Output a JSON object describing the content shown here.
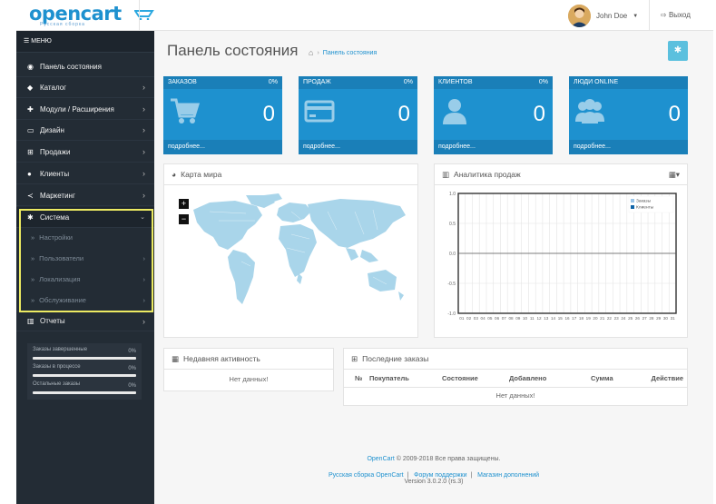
{
  "header": {
    "logo_text": "opencart",
    "logo_tagline": "Русская сборка",
    "user_name": "John Doe",
    "logout_label": "Выход"
  },
  "sidebar": {
    "menu_label": "МЕНЮ",
    "items": [
      {
        "label": "Панель состояния",
        "icon": "dashboard-icon"
      },
      {
        "label": "Каталог",
        "icon": "tag-icon"
      },
      {
        "label": "Модули / Расширения",
        "icon": "puzzle-icon"
      },
      {
        "label": "Дизайн",
        "icon": "monitor-icon"
      },
      {
        "label": "Продажи",
        "icon": "cart-icon"
      },
      {
        "label": "Клиенты",
        "icon": "user-icon"
      },
      {
        "label": "Маркетинг",
        "icon": "share-icon"
      },
      {
        "label": "Система",
        "icon": "gear-icon"
      }
    ],
    "system_subitems": [
      {
        "label": "Настройки"
      },
      {
        "label": "Пользователи"
      },
      {
        "label": "Локализация"
      },
      {
        "label": "Обслуживание"
      }
    ],
    "reports_label": "Отчеты",
    "stats": [
      {
        "label": "Заказы завершенные",
        "percent": "0%",
        "fill": 0
      },
      {
        "label": "Заказы в процессе",
        "percent": "0%",
        "fill": 0
      },
      {
        "label": "Остальные заказы",
        "percent": "0%",
        "fill": 0
      }
    ],
    "highlight_color": "#ecea62"
  },
  "main": {
    "page_title": "Панель состояния",
    "breadcrumb": "Панель состояния",
    "tiles": [
      {
        "label": "ЗАКАЗОВ",
        "percent": "0%",
        "value": "0",
        "more": "подробнее...",
        "icon": "cart-icon"
      },
      {
        "label": "ПРОДАЖ",
        "percent": "0%",
        "value": "0",
        "more": "подробнее...",
        "icon": "credit-card-icon"
      },
      {
        "label": "КЛИЕНТОВ",
        "percent": "0%",
        "value": "0",
        "more": "подробнее...",
        "icon": "user-icon"
      },
      {
        "label": "ЛЮДИ ONLINE",
        "percent": "",
        "value": "0",
        "more": "подробнее...",
        "icon": "users-icon"
      }
    ],
    "map_title": "Карта мира",
    "analytics_title": "Аналитика продаж",
    "activity_title": "Недавняя активность",
    "activity_empty": "Нет данных!",
    "orders_title": "Последние заказы",
    "orders_columns": [
      "№",
      "Покупатель",
      "Состояние",
      "Добавлено",
      "Сумма",
      "Действие"
    ],
    "orders_empty": "Нет данных!"
  },
  "chart_data": {
    "type": "line",
    "title": "",
    "x": [
      "01",
      "02",
      "03",
      "04",
      "05",
      "06",
      "07",
      "08",
      "09",
      "10",
      "11",
      "12",
      "13",
      "14",
      "15",
      "16",
      "17",
      "18",
      "19",
      "20",
      "21",
      "22",
      "23",
      "24",
      "25",
      "26",
      "27",
      "28",
      "29",
      "30",
      "31"
    ],
    "ylim": [
      -1.0,
      1.0
    ],
    "yticks": [
      "1.0",
      "0.5",
      "0.0",
      "-0.5",
      "-1.0"
    ],
    "series": [
      {
        "name": "Заказы",
        "color": "#9bc5e8",
        "values": []
      },
      {
        "name": "Клиенты",
        "color": "#1065a8",
        "values": []
      }
    ],
    "grid": true,
    "legend": "top-right"
  },
  "footer": {
    "copyright_link": "OpenCart",
    "copyright_text": " © 2009-2018 Все права защищены.",
    "links": [
      "Русская сборка OpenCart",
      "Форум поддержки",
      "Магазин дополнений"
    ],
    "version": "Version 3.0.2.0 (rs.3)"
  },
  "colors": {
    "accent": "#1e91cf",
    "sidebar": "#232c35",
    "info": "#5bc0de"
  }
}
